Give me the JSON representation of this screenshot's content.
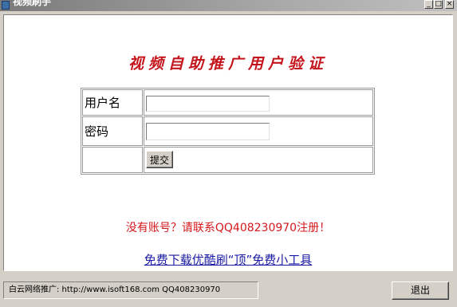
{
  "window": {
    "title": "视频刷手",
    "minimize_glyph": "_",
    "maximize_glyph": "□",
    "close_glyph": "×"
  },
  "heading": "视频自助推广用户验证",
  "form": {
    "username_label": "用户名",
    "username_value": "",
    "password_label": "密码",
    "password_value": "",
    "submit_label": "提交"
  },
  "register_note": "没有账号？请联系QQ408230970注册！",
  "download_link": "免费下载优酷刷“顶”免费小工具",
  "statusbar": {
    "text": "白云网络推广: http://www.isoft168.com QQ408230970"
  },
  "exit_label": "退出",
  "colors": {
    "heading": "#c4141c",
    "note": "#d4181c",
    "link": "#1a1aa6",
    "window_bg": "#d4d0c8"
  },
  "icons": {
    "title_icon": "app-icon"
  }
}
